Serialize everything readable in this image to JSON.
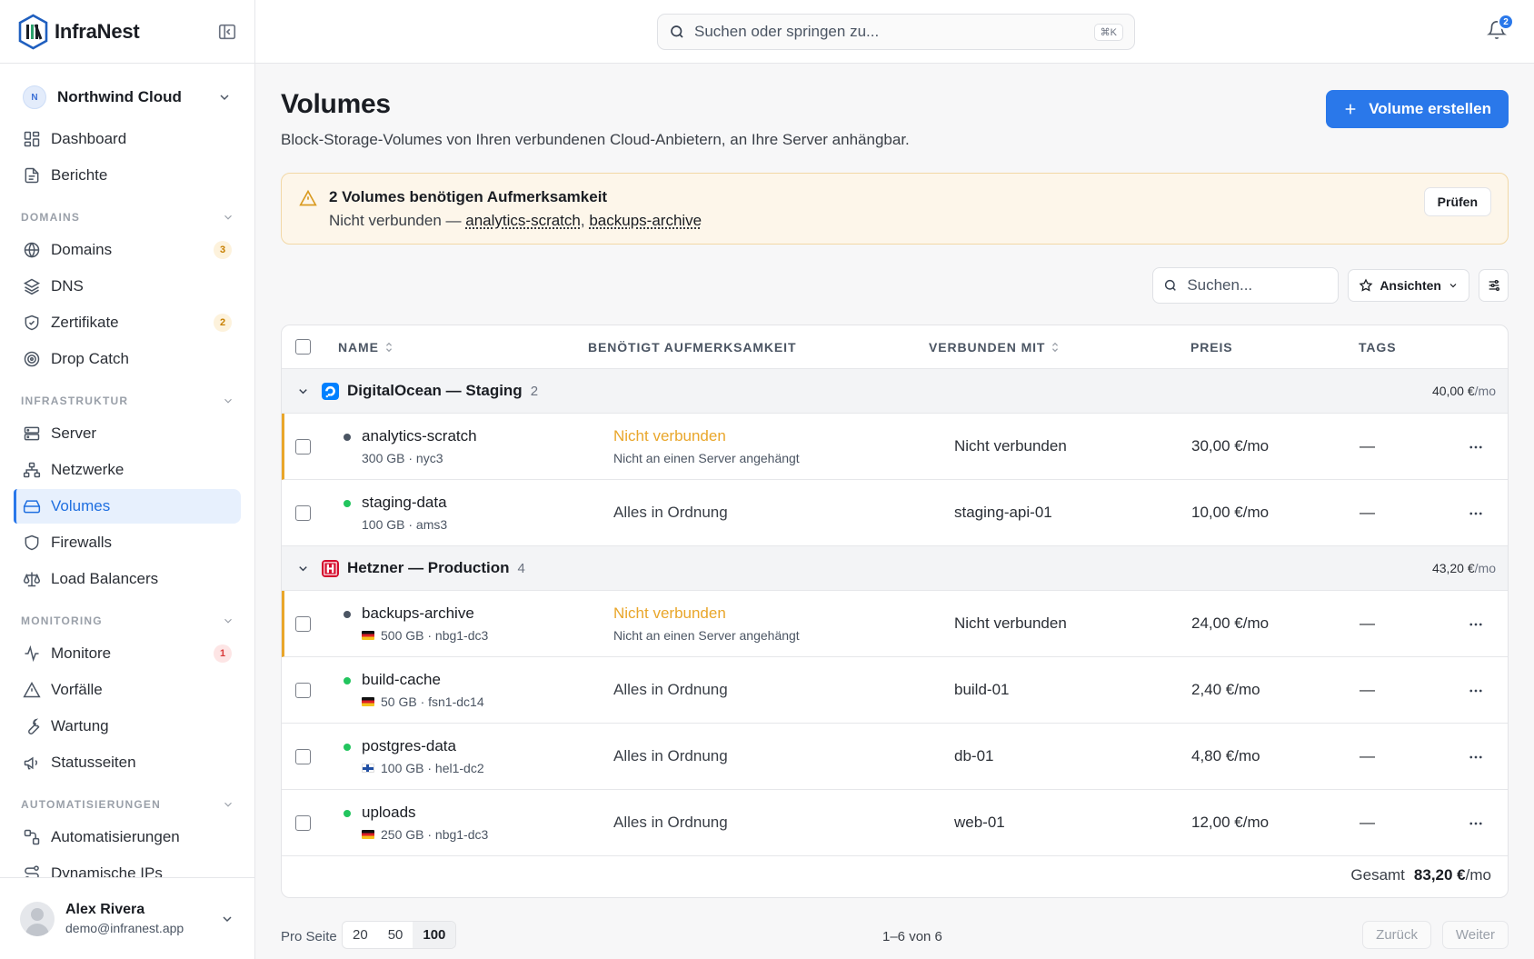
{
  "app": {
    "name": "InfraNest"
  },
  "org": {
    "initial": "N",
    "name": "Northwind Cloud"
  },
  "nav": {
    "top": [
      {
        "label": "Dashboard",
        "icon": "dashboard-icon"
      },
      {
        "label": "Berichte",
        "icon": "report-icon"
      }
    ],
    "domains_label": "DOMAINS",
    "domains": [
      {
        "label": "Domains",
        "icon": "globe-icon",
        "count": "3"
      },
      {
        "label": "DNS",
        "icon": "layers-icon"
      },
      {
        "label": "Zertifikate",
        "icon": "shield-check-icon",
        "count": "2"
      },
      {
        "label": "Drop Catch",
        "icon": "target-icon"
      }
    ],
    "infra_label": "INFRASTRUKTUR",
    "infra": [
      {
        "label": "Server",
        "icon": "server-icon"
      },
      {
        "label": "Netzwerke",
        "icon": "network-icon"
      },
      {
        "label": "Volumes",
        "icon": "hard-drive-icon",
        "active": true
      },
      {
        "label": "Firewalls",
        "icon": "shield-icon"
      },
      {
        "label": "Load Balancers",
        "icon": "scale-icon"
      }
    ],
    "monitoring_label": "MONITORING",
    "monitoring": [
      {
        "label": "Monitore",
        "icon": "activity-icon",
        "count": "1"
      },
      {
        "label": "Vorfälle",
        "icon": "alert-triangle-icon"
      },
      {
        "label": "Wartung",
        "icon": "wrench-icon"
      },
      {
        "label": "Statusseiten",
        "icon": "megaphone-icon"
      }
    ],
    "auto_label": "AUTOMATISIERUNGEN",
    "auto": [
      {
        "label": "Automatisierungen",
        "icon": "workflow-icon"
      },
      {
        "label": "Dynamische IPs",
        "icon": "route-icon"
      }
    ]
  },
  "user": {
    "name": "Alex Rivera",
    "email": "demo@infranest.app"
  },
  "topbar": {
    "search_placeholder": "Suchen oder springen zu...",
    "shortcut": "⌘K",
    "notifications": "2"
  },
  "page": {
    "title": "Volumes",
    "subtitle": "Block-Storage-Volumes von Ihren verbundenen Cloud-Anbietern, an Ihre Server anhängbar.",
    "create_label": "Volume erstellen"
  },
  "alert": {
    "title": "2 Volumes benötigen Aufmerksamkeit",
    "prefix": "Nicht verbunden —",
    "link1": "analytics-scratch",
    "sep": ",",
    "link2": "backups-archive",
    "button": "Prüfen"
  },
  "toolbar": {
    "search_placeholder": "Suchen...",
    "views_label": "Ansichten"
  },
  "table": {
    "headers": {
      "name": "NAME",
      "attention": "BENÖTIGT AUFMERKSAMKEIT",
      "connected": "VERBUNDEN MIT",
      "price": "PREIS",
      "tags": "TAGS"
    },
    "groups": [
      {
        "name": "DigitalOcean — Staging",
        "count": "2",
        "total": "40,00 €",
        "unit": "/mo",
        "rows": [
          {
            "name": "analytics-scratch",
            "meta": "300 GB · nyc3",
            "flag": "",
            "status": "gray",
            "attention": "Nicht verbunden",
            "attention_sub": "Nicht an einen Server angehängt",
            "warn": true,
            "connected": "Nicht verbunden",
            "price": "30,00 €/mo",
            "tags": "—"
          },
          {
            "name": "staging-data",
            "meta": "100 GB · ams3",
            "flag": "",
            "status": "green",
            "attention": "Alles in Ordnung",
            "attention_sub": "",
            "warn": false,
            "connected": "staging-api-01",
            "price": "10,00 €/mo",
            "tags": "—"
          }
        ]
      },
      {
        "name": "Hetzner — Production",
        "count": "4",
        "total": "43,20 €",
        "unit": "/mo",
        "rows": [
          {
            "name": "backups-archive",
            "meta": "500 GB · nbg1-dc3",
            "flag": "de",
            "status": "gray",
            "attention": "Nicht verbunden",
            "attention_sub": "Nicht an einen Server angehängt",
            "warn": true,
            "connected": "Nicht verbunden",
            "price": "24,00 €/mo",
            "tags": "—"
          },
          {
            "name": "build-cache",
            "meta": "50 GB · fsn1-dc14",
            "flag": "de",
            "status": "green",
            "attention": "Alles in Ordnung",
            "attention_sub": "",
            "warn": false,
            "connected": "build-01",
            "price": "2,40 €/mo",
            "tags": "—"
          },
          {
            "name": "postgres-data",
            "meta": "100 GB · hel1-dc2",
            "flag": "fi",
            "status": "green",
            "attention": "Alles in Ordnung",
            "attention_sub": "",
            "warn": false,
            "connected": "db-01",
            "price": "4,80 €/mo",
            "tags": "—"
          },
          {
            "name": "uploads",
            "meta": "250 GB · nbg1-dc3",
            "flag": "de",
            "status": "green",
            "attention": "Alles in Ordnung",
            "attention_sub": "",
            "warn": false,
            "connected": "web-01",
            "price": "12,00 €/mo",
            "tags": "—"
          }
        ]
      }
    ],
    "total_label": "Gesamt",
    "total_value": "83,20 €",
    "total_unit": "/mo"
  },
  "pager": {
    "per_page_label": "Pro Seite",
    "sizes": [
      "20",
      "50",
      "100"
    ],
    "selected": "100",
    "info": "1–6 von 6",
    "prev": "Zurück",
    "next": "Weiter"
  },
  "colors": {
    "accent": "#2a78ea",
    "warning": "#e9a62a",
    "ok": "#22c55e",
    "danger": "#d93a3a",
    "hetzner": "#d50c2d",
    "digitalocean": "#0080ff"
  }
}
